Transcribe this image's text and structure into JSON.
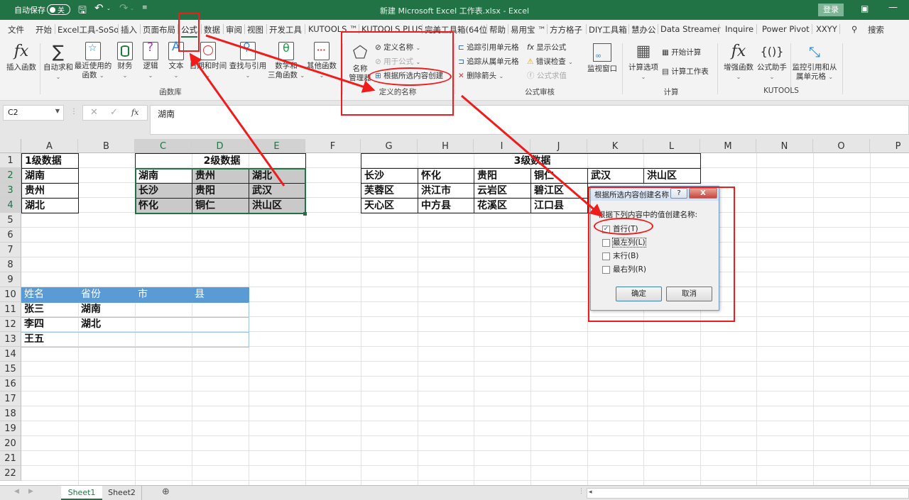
{
  "titlebar": {
    "autosave_label": "自动保存",
    "autosave_state": "关",
    "title": "新建 Microsoft Excel 工作表.xlsx  -  Excel",
    "login_label": "登录"
  },
  "tabs": [
    {
      "label": "文件"
    },
    {
      "label": "开始"
    },
    {
      "label": "Excel工具-SoSo"
    },
    {
      "label": "插入"
    },
    {
      "label": "页面布局"
    },
    {
      "label": "公式",
      "active": true
    },
    {
      "label": "数据"
    },
    {
      "label": "审阅"
    },
    {
      "label": "视图"
    },
    {
      "label": "开发工具"
    },
    {
      "label": "KUTOOLS ™"
    },
    {
      "label": "KUTOOLS PLUS"
    },
    {
      "label": "完美工具箱(64位"
    },
    {
      "label": "帮助"
    },
    {
      "label": "易用宝 ™"
    },
    {
      "label": "方方格子"
    },
    {
      "label": "DIY工具箱"
    },
    {
      "label": "慧办公"
    },
    {
      "label": "Data Streamer"
    },
    {
      "label": "Inquire"
    },
    {
      "label": "Power Pivot"
    },
    {
      "label": "XXYY"
    },
    {
      "label": "搜索"
    }
  ],
  "ribbon": {
    "function_library": {
      "group_label": "函数库",
      "insert_function": "插入函数",
      "autosum": "自动求和",
      "recent_1": "最近使用的",
      "recent_2": "函数",
      "financial": "财务",
      "logical": "逻辑",
      "text": "文本",
      "datetime": "日期和时间",
      "lookup": "查找与引用",
      "math_1": "数学和",
      "math_2": "三角函数",
      "more": "其他函数"
    },
    "defined_names": {
      "group_label": "定义的名称",
      "name_manager_1": "名称",
      "name_manager_2": "管理器",
      "define_name": "定义名称",
      "use_in_formula": "用于公式",
      "create_from_selection": "根据所选内容创建"
    },
    "formula_auditing": {
      "group_label": "公式审核",
      "trace_precedents": "追踪引用单元格",
      "trace_dependents": "追踪从属单元格",
      "remove_arrows": "删除箭头",
      "show_formulas": "显示公式",
      "error_checking": "错误检查",
      "evaluate_formula": "公式求值",
      "watch_window": "监视窗口"
    },
    "calculation": {
      "group_label": "计算",
      "calc_options": "计算选项",
      "calc_now": "开始计算",
      "calc_sheet": "计算工作表"
    },
    "kutools": {
      "group_label": "KUTOOLS",
      "enhanced_func": "增强函数",
      "formula_helper": "公式助手",
      "monitor_1": "监控引用和从",
      "monitor_2": "属单元格"
    }
  },
  "formula_bar": {
    "name_box": "C2",
    "formula": "湖南"
  },
  "columns": [
    "A",
    "B",
    "C",
    "D",
    "E",
    "F",
    "G",
    "H",
    "I",
    "J",
    "K",
    "L",
    "M",
    "N",
    "O",
    "P"
  ],
  "rows": [
    "1",
    "2",
    "3",
    "4",
    "5",
    "6",
    "7",
    "8",
    "9",
    "10",
    "11",
    "12",
    "13",
    "14",
    "15",
    "16",
    "17",
    "18",
    "19",
    "20",
    "21",
    "22"
  ],
  "sheet": {
    "level1": {
      "header": "1级数据",
      "values": [
        "湖南",
        "贵州",
        "湖北"
      ]
    },
    "level2": {
      "header": "2级数据",
      "rows": [
        [
          "湖南",
          "贵州",
          "湖北"
        ],
        [
          "长沙",
          "贵阳",
          "武汉"
        ],
        [
          "怀化",
          "铜仁",
          "洪山区"
        ]
      ]
    },
    "level3": {
      "header": "3级数据",
      "rows": [
        [
          "长沙",
          "怀化",
          "贵阳",
          "铜仁",
          "武汉",
          "洪山区"
        ],
        [
          "芙蓉区",
          "洪江市",
          "云岩区",
          "碧江区",
          "",
          ""
        ],
        [
          "天心区",
          "中方县",
          "花溪区",
          "江口县",
          "",
          ""
        ]
      ]
    },
    "table": {
      "headers": [
        "姓名",
        "省份",
        "市",
        "县"
      ],
      "rows": [
        [
          "张三",
          "湖南",
          "",
          ""
        ],
        [
          "李四",
          "湖北",
          "",
          ""
        ],
        [
          "王五",
          "",
          "",
          ""
        ]
      ]
    }
  },
  "dialog": {
    "title": "根据所选内容创建名称",
    "help": "?",
    "close": "X",
    "prompt": "根据下列内容中的值创建名称:",
    "options": [
      {
        "label": "首行(T)",
        "checked": true
      },
      {
        "label": "最左列(L)",
        "checked": false
      },
      {
        "label": "末行(B)",
        "checked": false
      },
      {
        "label": "最右列(R)",
        "checked": false
      }
    ],
    "ok": "确定",
    "cancel": "取消"
  },
  "sheet_tabs": [
    {
      "label": "Sheet1",
      "active": true
    },
    {
      "label": "Sheet2",
      "active": false
    }
  ],
  "colors": {
    "excel_green": "#217346",
    "annotation_red": "#f01b1b",
    "table_header_blue": "#5b9bd5",
    "selection_gray": "#c9c9c9"
  }
}
